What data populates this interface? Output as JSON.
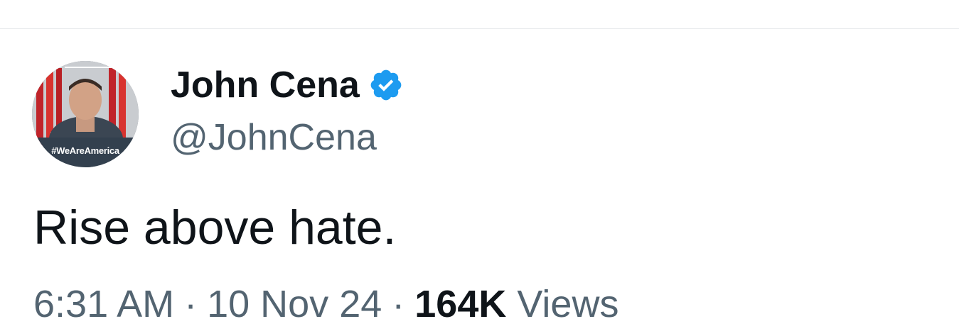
{
  "tweet": {
    "author": {
      "display_name": "John Cena",
      "handle": "@JohnCena",
      "verified": true,
      "verified_icon": "verified-badge-icon",
      "avatar_overlay_text": "#WeAreAmerica"
    },
    "text": "Rise above hate.",
    "meta": {
      "time": "6:31 AM",
      "separator": "·",
      "date": "10 Nov 24",
      "views_count": "164K",
      "views_label": "Views"
    }
  },
  "colors": {
    "text_primary": "#0f1419",
    "text_secondary": "#536471",
    "verified_blue": "#1d9bf0",
    "divider": "#e6e9ec"
  }
}
